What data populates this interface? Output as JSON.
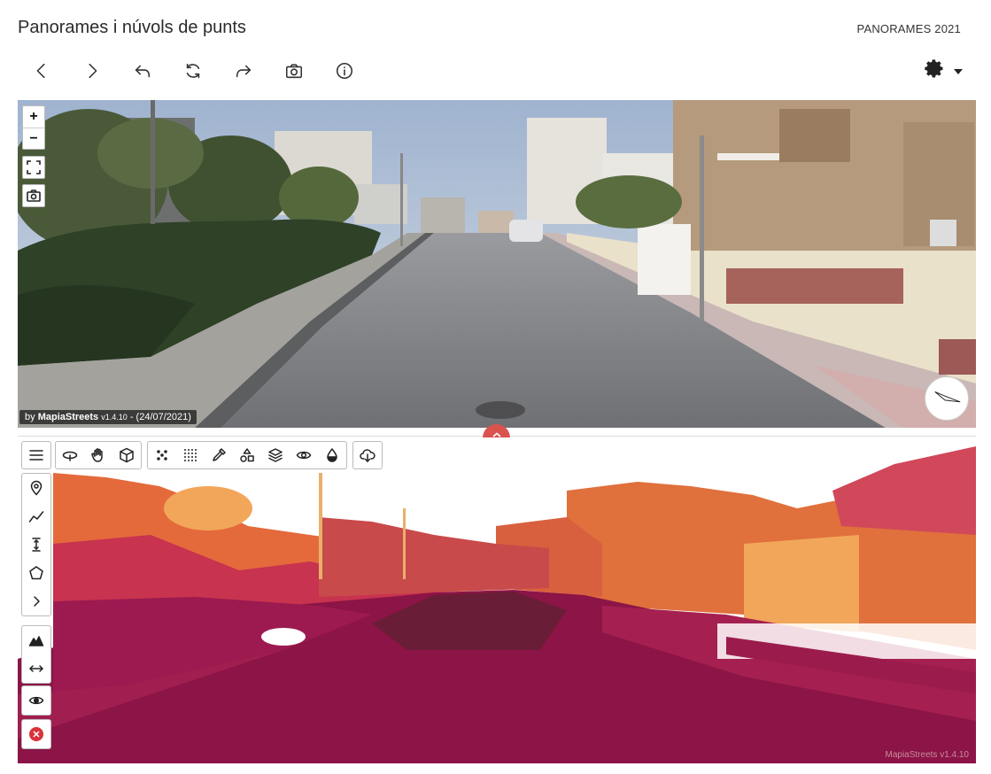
{
  "header": {
    "title": "Panorames i núvols de punts",
    "dataset": "PANORAMES 2021"
  },
  "toolbar": {
    "buttons": [
      {
        "name": "previous",
        "icon": "chevron-left-icon"
      },
      {
        "name": "next",
        "icon": "chevron-right-icon"
      },
      {
        "name": "undo",
        "icon": "undo-icon"
      },
      {
        "name": "refresh",
        "icon": "refresh-icon"
      },
      {
        "name": "redo",
        "icon": "redo-icon"
      },
      {
        "name": "snapshot",
        "icon": "camera-icon"
      },
      {
        "name": "info",
        "icon": "info-icon"
      }
    ],
    "settings_icon": "gear-icon"
  },
  "panorama": {
    "zoom_in": "+",
    "zoom_out": "−",
    "attribution_prefix": "by ",
    "attribution_brand": "MapiaStreets",
    "attribution_version": "v1.4.10",
    "attribution_date": " - (24/07/2021)",
    "compass_icon": "compass-icon"
  },
  "pointcloud": {
    "watermark": "MapiaStreets v1.4.10",
    "top_tools": [
      "menu-icon",
      "orbit-icon",
      "pan-hand-icon",
      "cube-icon",
      "points-sparse-icon",
      "points-dense-icon",
      "pipette-icon",
      "shapes-icon",
      "layers-icon",
      "eye-icon",
      "drop-icon",
      "cloud-download-icon"
    ],
    "side_tools": [
      "location-pin-icon",
      "polyline-icon",
      "height-measure-icon",
      "polygon-icon",
      "chevron-right-icon",
      "terrain-profile-icon",
      "distance-arrows-icon",
      "eye-icon",
      "close-icon"
    ]
  },
  "colors": {
    "accent_red": "#d9534f",
    "cloud_ground": "#8c1446",
    "cloud_mid": "#c8334f",
    "cloud_high": "#e9793a",
    "cloud_top": "#f2b86a"
  }
}
